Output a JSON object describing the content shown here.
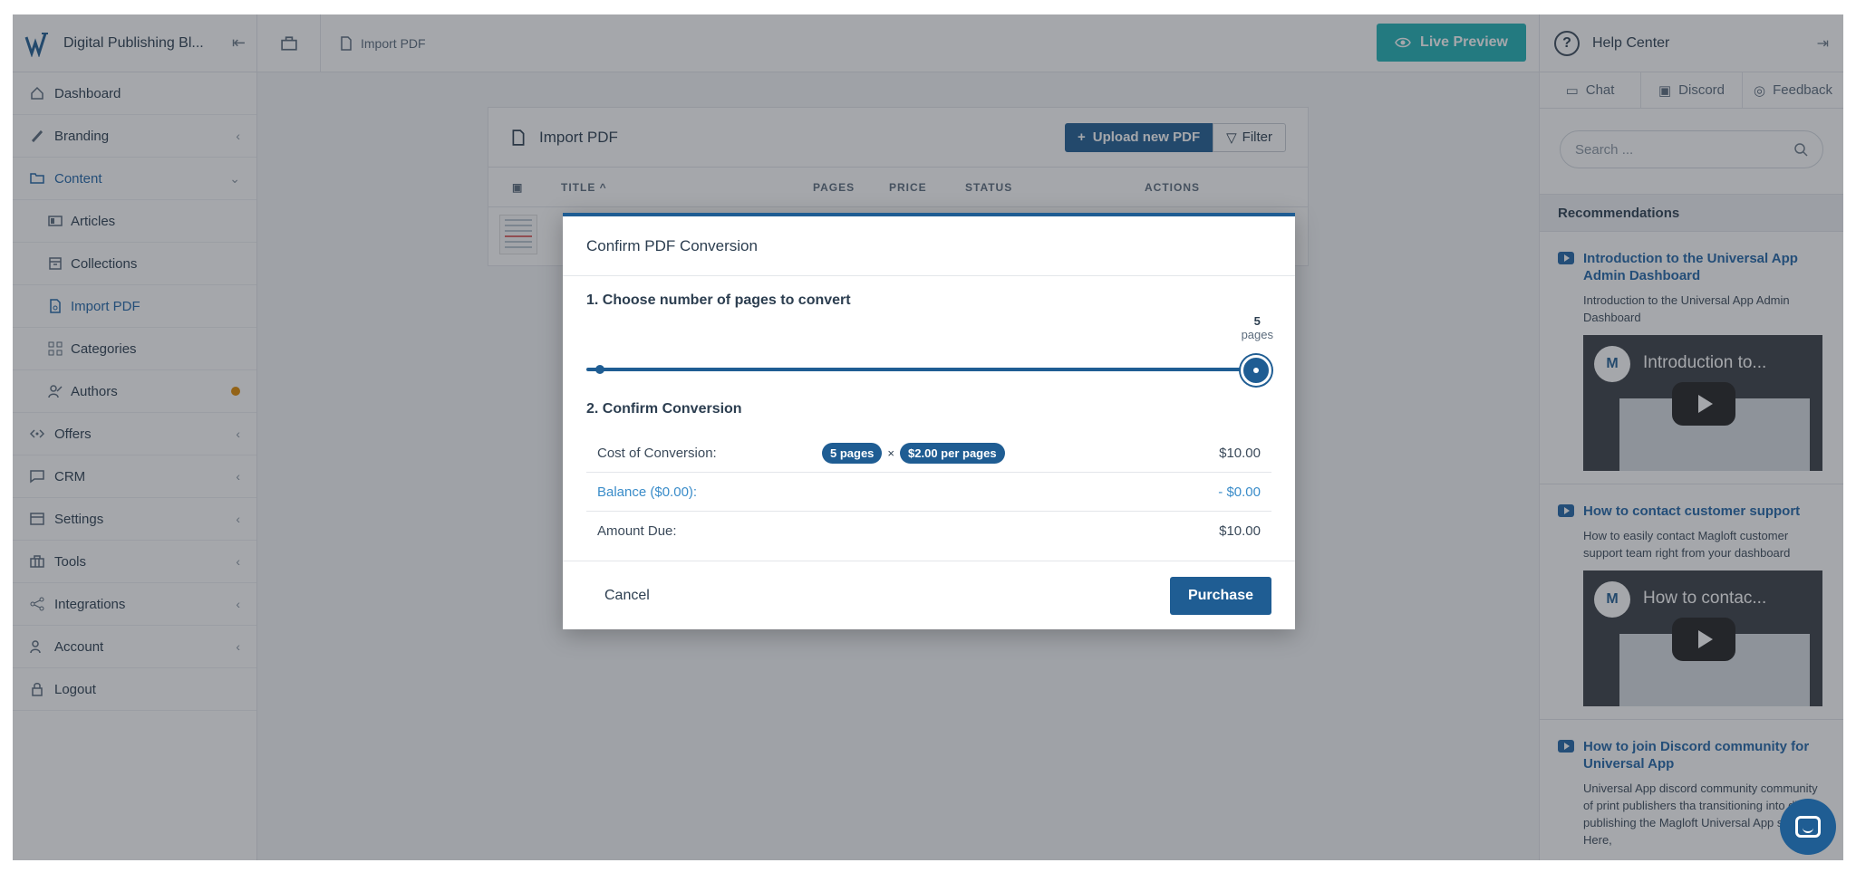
{
  "sidebar": {
    "brand": "Digital Publishing Bl...",
    "items": [
      {
        "label": "Dashboard"
      },
      {
        "label": "Branding",
        "chevron": "‹"
      },
      {
        "label": "Content",
        "chevron": "⌄"
      },
      {
        "label": "Articles"
      },
      {
        "label": "Collections"
      },
      {
        "label": "Import PDF"
      },
      {
        "label": "Categories"
      },
      {
        "label": "Authors"
      },
      {
        "label": "Offers",
        "chevron": "‹"
      },
      {
        "label": "CRM",
        "chevron": "‹"
      },
      {
        "label": "Settings",
        "chevron": "‹"
      },
      {
        "label": "Tools",
        "chevron": "‹"
      },
      {
        "label": "Integrations",
        "chevron": "‹"
      },
      {
        "label": "Account",
        "chevron": "‹"
      },
      {
        "label": "Logout"
      }
    ]
  },
  "topbar": {
    "breadcrumb": "Import PDF",
    "live_preview": "Live Preview"
  },
  "card": {
    "title": "Import PDF",
    "upload_button": "Upload new PDF",
    "filter_button": "Filter",
    "columns": [
      "TITLE",
      "PAGES",
      "PRICE",
      "STATUS",
      "ACTIONS"
    ]
  },
  "help": {
    "title": "Help Center",
    "tabs": [
      "Chat",
      "Discord",
      "Feedback"
    ],
    "search_placeholder": "Search ...",
    "recommendations_title": "Recommendations",
    "items": [
      {
        "title": "Introduction to the Universal App Admin Dashboard",
        "desc": "Introduction to the Universal App Admin Dashboard",
        "video_title": "Introduction to..."
      },
      {
        "title": "How to contact customer support",
        "desc": "How to easily contact Magloft customer support team right from your dashboard",
        "video_title": "How to contac..."
      },
      {
        "title": "How to join Discord community for Universal App",
        "desc": "Universal App discord community community of print publishers tha transitioning into digital publishing the Magloft Universal App solution. Here,"
      }
    ]
  },
  "modal": {
    "title": "Confirm PDF Conversion",
    "step1": "1. Choose number of pages to convert",
    "slider_value": "5",
    "slider_unit": "pages",
    "slider_fraction": 1.0,
    "step2": "2. Confirm Conversion",
    "rows": [
      {
        "label": "Cost of Conversion:",
        "value": "$10.00"
      },
      {
        "label": "Balance ($0.00):",
        "value": "- $0.00"
      },
      {
        "label": "Amount Due:",
        "value": "$10.00"
      }
    ],
    "pill_pages": "5 pages",
    "pill_times": "×",
    "pill_price": "$2.00 per pages",
    "cancel": "Cancel",
    "purchase": "Purchase"
  },
  "colors": {
    "primary": "#1f5d93",
    "live_preview": "#20b2b6",
    "author_dot": "#e08a00",
    "link": "#2266a8"
  }
}
